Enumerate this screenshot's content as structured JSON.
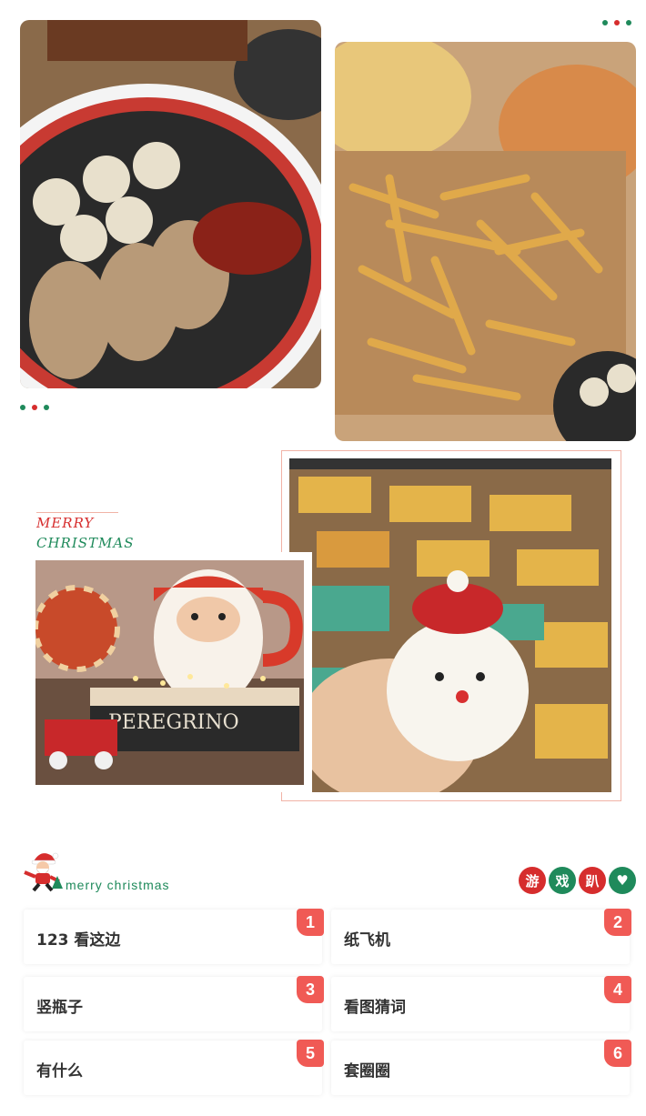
{
  "colors": {
    "green": "#1f8a5b",
    "red": "#d62d2d",
    "accent": "#f05a55"
  },
  "photos": [
    {
      "name": "sushi-platter-photo",
      "icon": "sushi-photo"
    },
    {
      "name": "pizza-fries-photo",
      "icon": "fries-photo"
    },
    {
      "name": "santa-mug-photo",
      "icon": "santa-mug-photo"
    },
    {
      "name": "santa-cupcake-photo",
      "icon": "cupcake-photo"
    }
  ],
  "merry_block": {
    "line1": "MERRY",
    "line2": "CHRISTMAS"
  },
  "game_header": {
    "subtitle": "merry christmas",
    "badges": [
      "游",
      "戏",
      "趴",
      "♥"
    ]
  },
  "games": [
    {
      "label": "123 看这边",
      "num": "1"
    },
    {
      "label": "纸飞机",
      "num": "2"
    },
    {
      "label": "竖瓶子",
      "num": "3"
    },
    {
      "label": "看图猜词",
      "num": "4"
    },
    {
      "label": "有什么",
      "num": "5"
    },
    {
      "label": "套圈圈",
      "num": "6"
    }
  ]
}
